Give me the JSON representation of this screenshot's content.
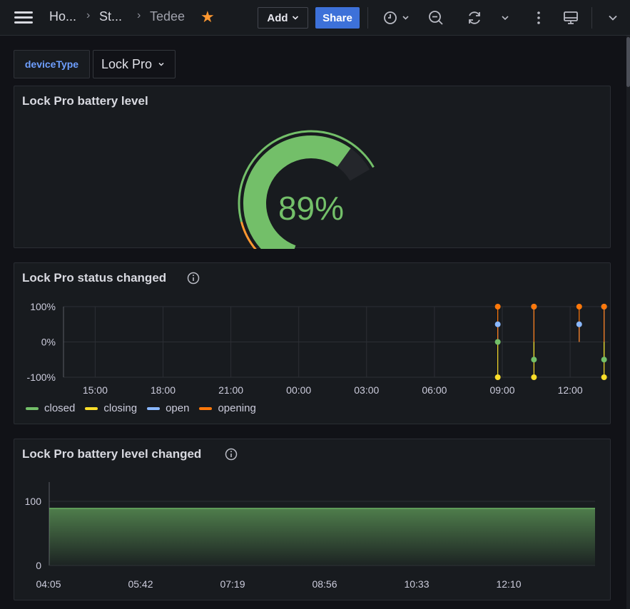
{
  "topbar": {
    "breadcrumbs": [
      "Ho...",
      "St...",
      "Tedee"
    ],
    "add_label": "Add",
    "share_label": "Share"
  },
  "variable": {
    "name": "deviceType",
    "value": "Lock Pro"
  },
  "panels": {
    "gauge": {
      "title": "Lock Pro battery level",
      "value_text": "89%"
    },
    "status": {
      "title": "Lock Pro status changed",
      "legend": [
        {
          "name": "closed",
          "color": "#73bf69"
        },
        {
          "name": "closing",
          "color": "#fade2a"
        },
        {
          "name": "open",
          "color": "#8ab8ff"
        },
        {
          "name": "opening",
          "color": "#ff780a"
        }
      ]
    },
    "battery_changed": {
      "title": "Lock Pro battery level changed"
    }
  },
  "chart_data": [
    {
      "type": "gauge",
      "value": 89,
      "unit": "%",
      "min": 0,
      "max": 100,
      "thresholds": [
        {
          "from": 0,
          "to": 10,
          "color": "#f2495c"
        },
        {
          "from": 10,
          "to": 25,
          "color": "#ff9830"
        },
        {
          "from": 25,
          "to": 100,
          "color": "#73bf69"
        }
      ]
    },
    {
      "type": "line",
      "y_tick_labels": [
        "100%",
        "0%",
        "-100%"
      ],
      "y_ticks": [
        100,
        0,
        -100
      ],
      "ylim": [
        -100,
        100
      ],
      "x_tick_labels": [
        "15:00",
        "18:00",
        "21:00",
        "00:00",
        "03:00",
        "06:00",
        "09:00",
        "12:00"
      ],
      "x_ticks_hours": [
        15,
        18,
        21,
        24,
        27,
        30,
        33,
        36
      ],
      "xlim_hours": [
        13.6,
        37.7
      ],
      "grid": true,
      "legend_position": "bottom-left",
      "series": [
        {
          "name": "closed",
          "color": "#73bf69",
          "x_hours": [
            32.8,
            34.4,
            37.5
          ],
          "values": [
            0,
            -50,
            -50
          ]
        },
        {
          "name": "closing",
          "color": "#fade2a",
          "x_hours": [
            32.8,
            34.4,
            37.5
          ],
          "values": [
            -100,
            -100,
            -100
          ]
        },
        {
          "name": "open",
          "color": "#8ab8ff",
          "x_hours": [
            32.8,
            34.4,
            36.4,
            37.5
          ],
          "values": [
            50,
            100,
            50,
            100
          ]
        },
        {
          "name": "opening",
          "color": "#ff780a",
          "x_hours": [
            32.8,
            34.4,
            36.4,
            37.5
          ],
          "values": [
            100,
            100,
            100,
            100
          ]
        }
      ]
    },
    {
      "type": "area",
      "x_tick_labels": [
        "04:05",
        "05:42",
        "07:19",
        "08:56",
        "10:33",
        "12:10"
      ],
      "y_tick_labels": [
        "100",
        "0"
      ],
      "y_ticks": [
        100,
        0
      ],
      "ylim": [
        0,
        130
      ],
      "series": [
        {
          "name": "",
          "color": "#73bf69",
          "values": [
            89,
            89,
            89,
            89,
            89,
            89,
            89
          ]
        }
      ]
    }
  ]
}
